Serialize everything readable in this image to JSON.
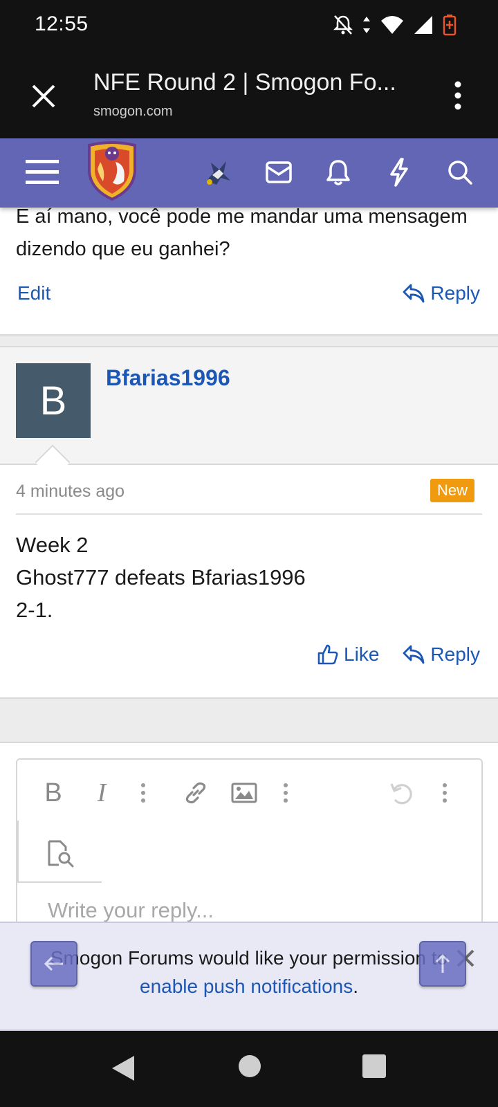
{
  "status_bar": {
    "time": "12:55"
  },
  "browser": {
    "title": "NFE Round 2 | Smogon Fo...",
    "url": "smogon.com"
  },
  "site_nav": {
    "brand_color": "#6366b4"
  },
  "previous_post": {
    "text": "E aí mano, você pode me mandar uma mensagem dizendo que eu ganhei?",
    "edit_label": "Edit",
    "reply_label": "Reply"
  },
  "post": {
    "avatar_letter": "B",
    "username": "Bfarias1996",
    "time": "4 minutes ago",
    "badge": "New",
    "body": [
      "Week 2",
      "Ghost777 defeats Bfarias1996",
      "2-1."
    ],
    "like_label": "Like",
    "reply_label": "Reply"
  },
  "editor": {
    "placeholder": "Write your reply..."
  },
  "push": {
    "text_before": "Smogon Forums would like your permission to",
    "link_text": "enable push notifications",
    "text_after": "."
  }
}
